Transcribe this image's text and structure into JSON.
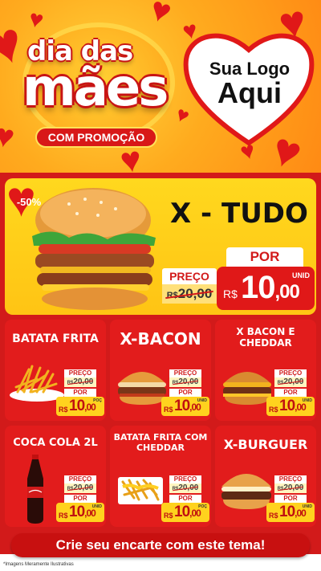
{
  "header": {
    "title_line1": "dia das",
    "title_line2": "mães",
    "promo_label": "COM PROMOÇÃO",
    "logo_line1": "Sua Logo",
    "logo_line2": "Aqui"
  },
  "hero": {
    "discount": "-50%",
    "name": "X - TUDO",
    "old_label": "PREÇO",
    "old_currency": "R$",
    "old_value": "20,00",
    "new_label": "POR",
    "new_currency": "R$",
    "new_value_int": "10",
    "new_value_cents": ",00",
    "unit": "UNID"
  },
  "products": [
    {
      "name": "BATATA FRITA",
      "old_label": "PREÇO",
      "old_value": "20,00",
      "new_label": "POR",
      "new_value_int": "10",
      "new_value_cents": ",00",
      "unit": "POÇ"
    },
    {
      "name": "X-BACON",
      "old_label": "PREÇO",
      "old_value": "20,00",
      "new_label": "POR",
      "new_value_int": "10",
      "new_value_cents": ",00",
      "unit": "UNID"
    },
    {
      "name": "X BACON E CHEDDAR",
      "old_label": "PREÇO",
      "old_value": "20,00",
      "new_label": "POR",
      "new_value_int": "10",
      "new_value_cents": ",00",
      "unit": "UNID"
    },
    {
      "name": "COCA COLA 2L",
      "old_label": "PREÇO",
      "old_value": "20,00",
      "new_label": "POR",
      "new_value_int": "10",
      "new_value_cents": ",00",
      "unit": "UNID"
    },
    {
      "name": "BATATA FRITA COM CHEDDAR",
      "old_label": "PREÇO",
      "old_value": "20,00",
      "new_label": "POR",
      "new_value_int": "10",
      "new_value_cents": ",00",
      "unit": "POÇ"
    },
    {
      "name": "X-BURGUER",
      "old_label": "PREÇO",
      "old_value": "20,00",
      "new_label": "POR",
      "new_value_int": "10",
      "new_value_cents": ",00",
      "unit": "UNID"
    }
  ],
  "currency": "R$",
  "cta": "Crie seu encarte com este tema!",
  "disclaimer": "*Imagens Meramente Ilustrativas",
  "colors": {
    "primary_red": "#e21c1c",
    "yellow": "#ffd21e",
    "orange": "#ff9a14"
  }
}
